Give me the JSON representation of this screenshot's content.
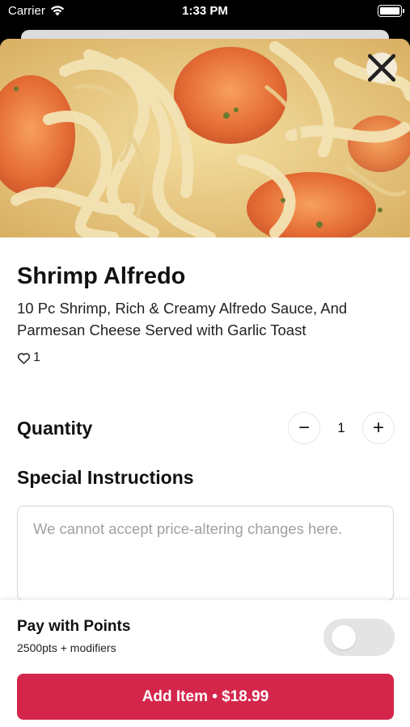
{
  "status_bar": {
    "carrier": "Carrier",
    "time": "1:33 PM",
    "icons": [
      "wifi-icon",
      "battery-icon"
    ]
  },
  "hero": {
    "image_semantic": "shrimp-alfredo-photo",
    "close_icon": "close-icon"
  },
  "item": {
    "title": "Shrimp Alfredo",
    "description": "10 Pc Shrimp, Rich & Creamy Alfredo Sauce, And Parmesan Cheese Served with Garlic Toast",
    "likes_count": "1",
    "likes_icon": "heart-outline-icon"
  },
  "quantity": {
    "label": "Quantity",
    "value": "1",
    "decrement_label": "−",
    "increment_label": "+"
  },
  "special_instructions": {
    "label": "Special Instructions",
    "placeholder": "We cannot accept price-altering changes here.",
    "value": ""
  },
  "points": {
    "label": "Pay with Points",
    "sublabel": "2500pts + modifiers",
    "enabled": false
  },
  "add_button": {
    "label": "Add Item • $18.99"
  },
  "colors": {
    "accent": "#d4264b",
    "toggle_off": "#e4e4e4"
  }
}
